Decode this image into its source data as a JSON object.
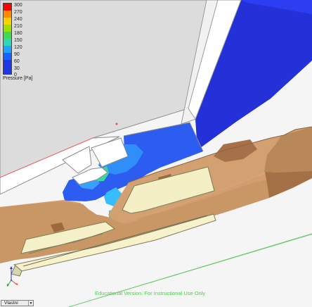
{
  "legend": {
    "ticks": [
      "300",
      "270",
      "240",
      "210",
      "180",
      "150",
      "120",
      "90",
      "60",
      "30",
      "0"
    ],
    "title": "Pressure [Pa]"
  },
  "watermark": "Educational Version. For Instructional Use Only",
  "view_select": {
    "value": "Vlastní"
  },
  "icons": {
    "dropdown": "chevron-down-icon",
    "axes": "axis-triad-icon"
  }
}
